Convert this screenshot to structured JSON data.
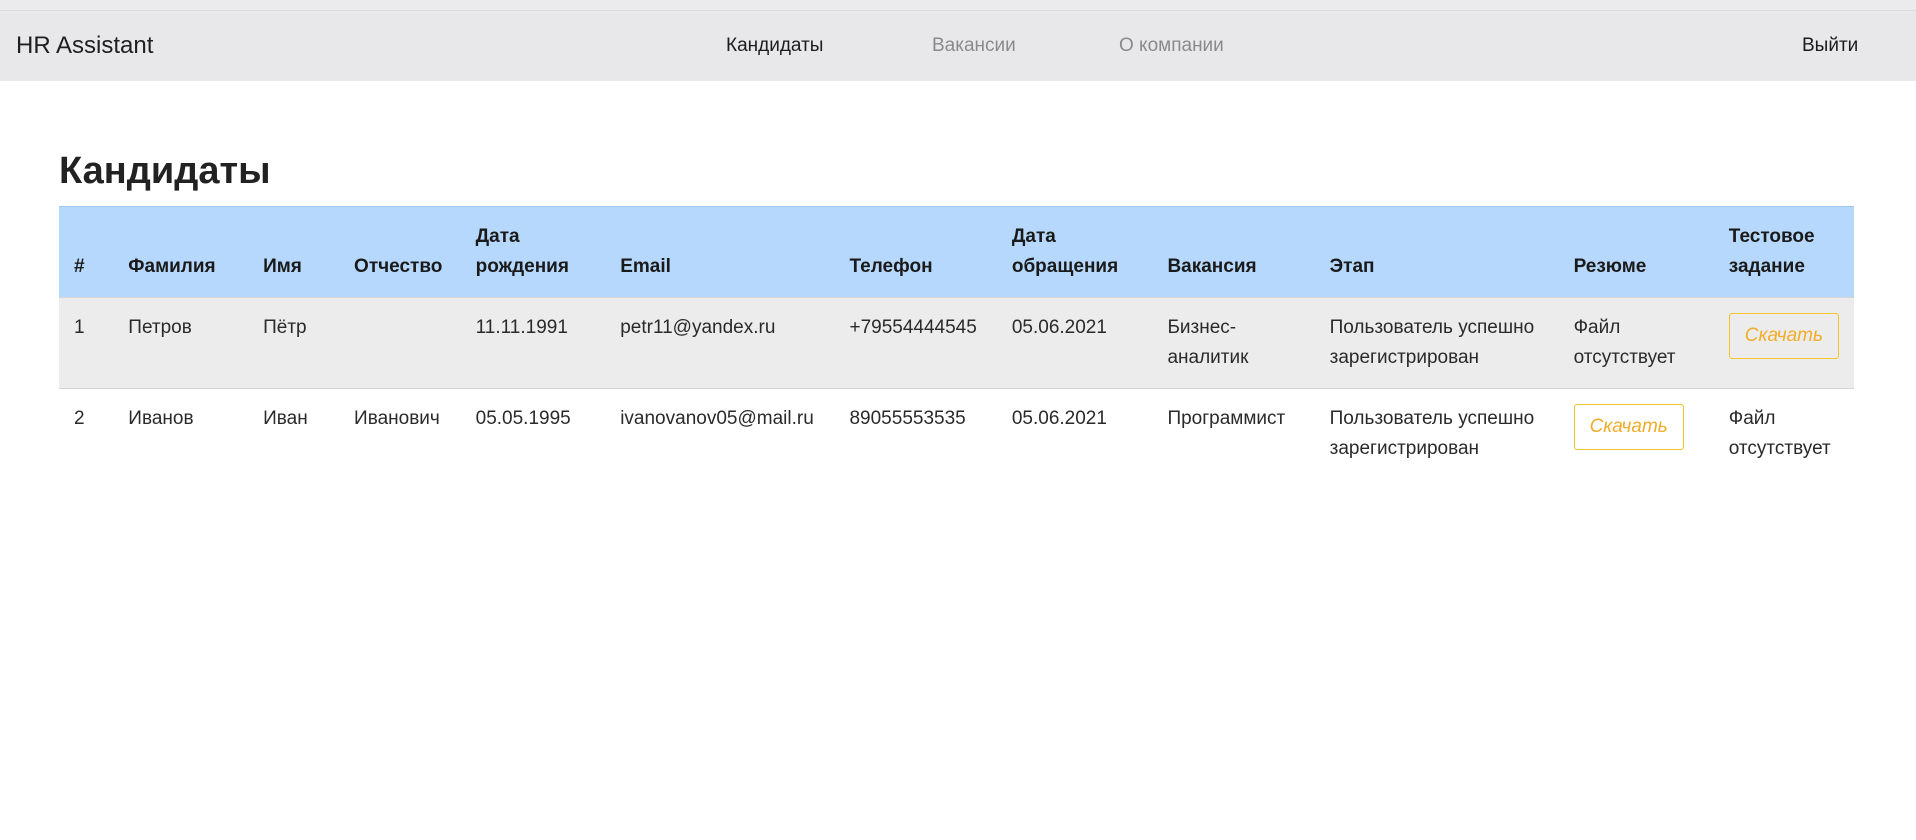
{
  "navbar": {
    "brand": "HR Assistant",
    "links": [
      {
        "label": "Кандидаты",
        "active": true
      },
      {
        "label": "Вакансии",
        "active": false
      },
      {
        "label": "О компании",
        "active": false
      }
    ],
    "logout": "Выйти"
  },
  "page": {
    "title": "Кандидаты"
  },
  "table": {
    "headers": {
      "num": "#",
      "last_name": "Фамилия",
      "first_name": "Имя",
      "middle_name": "Отчество",
      "dob": "Дата рождения",
      "email": "Email",
      "phone": "Телефон",
      "applied": "Дата обращения",
      "vacancy": "Вакансия",
      "stage": "Этап",
      "resume": "Резюме",
      "test_task": "Тестовое задание"
    },
    "rows": [
      {
        "num": "1",
        "last_name": "Петров",
        "first_name": "Пётр",
        "middle_name": "",
        "dob": "11.11.1991",
        "email": "petr11@yandex.ru",
        "phone": "+79554444545",
        "applied": "05.06.2021",
        "vacancy": "Бизнес-аналитик",
        "stage": "Пользователь успешно зарегистрирован",
        "resume": "Файл отсутствует",
        "test_task": "Скачать"
      },
      {
        "num": "2",
        "last_name": "Иванов",
        "first_name": "Иван",
        "middle_name": "Иванович",
        "dob": "05.05.1995",
        "email": "ivanovanov05@mail.ru",
        "phone": "89055553535",
        "applied": "05.06.2021",
        "vacancy": "Программист",
        "stage": "Пользователь успешно зарегистрирован",
        "resume": "Скачать",
        "test_task": "Файл отсутствует"
      }
    ]
  },
  "colors": {
    "navbar_bg": "#e8e8ea",
    "table_header_bg": "#b6d8fd",
    "striped_row_bg": "#ececec",
    "download_accent": "#f0ad2a"
  }
}
